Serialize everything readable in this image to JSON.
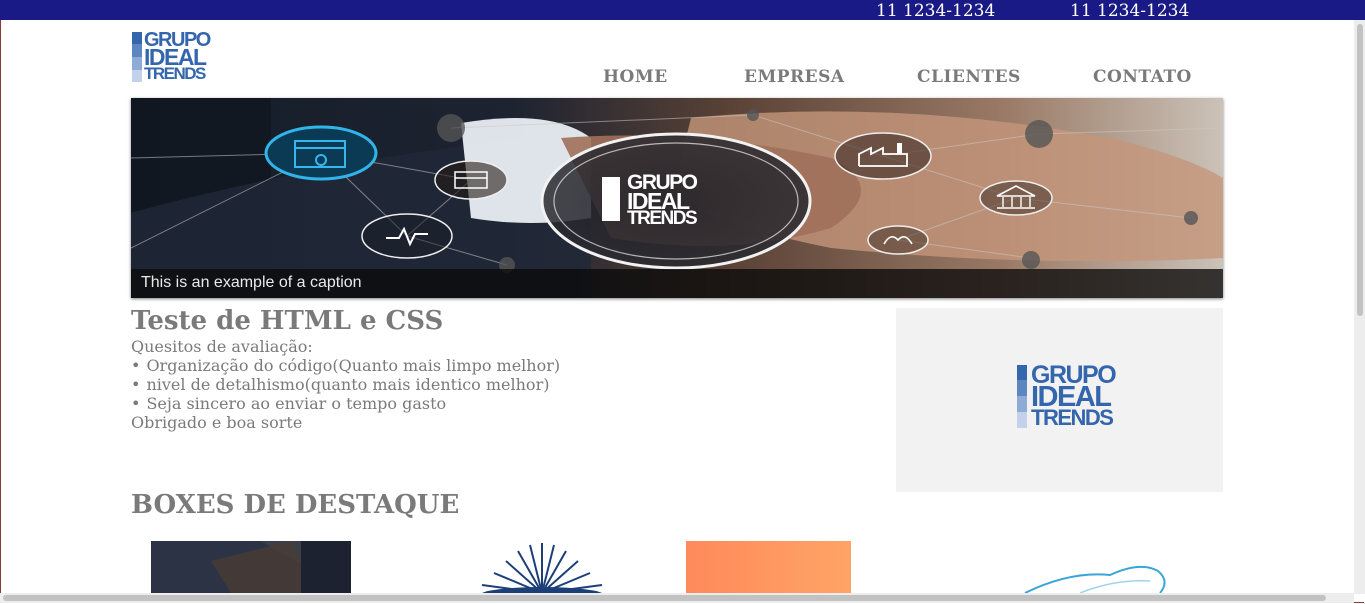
{
  "header": {
    "phones": [
      "11 1234-1234",
      "11 1234-1234"
    ]
  },
  "logo": {
    "lines": [
      "GRUPO",
      "IDEAL",
      "TRENDS"
    ],
    "colors": [
      "#3466ad",
      "#5b86c2",
      "#8eaad6",
      "#c3d1ea"
    ]
  },
  "nav": {
    "items": [
      "HOME",
      "EMPRESA",
      "CLIENTES",
      "CONTATO"
    ]
  },
  "carousel": {
    "caption": "This is an example of a caption",
    "center_logo_lines": [
      "GRUPO",
      "IDEAL",
      "TRENDS"
    ],
    "icons": [
      "browser-settings-icon",
      "store-icon",
      "health-pulse-icon",
      "factory-icon",
      "government-building-icon",
      "handshake-care-icon"
    ]
  },
  "intro": {
    "title": "Teste de HTML e CSS",
    "subtitle": "Quesitos de avaliação:",
    "items": [
      "Organização do código(Quanto mais limpo melhor)",
      "nivel de detalhismo(quanto mais identico melhor)",
      "Seja sincero ao enviar o tempo gasto"
    ],
    "closing": "Obrigado e boa sorte"
  },
  "boxes": {
    "title": "BOXES DE DESTAQUE"
  }
}
